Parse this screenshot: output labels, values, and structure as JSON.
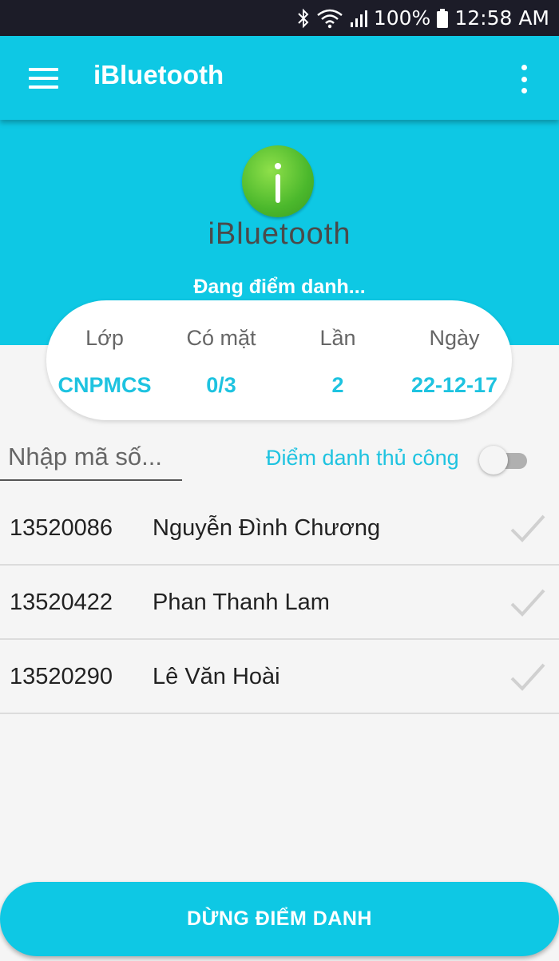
{
  "status_bar": {
    "battery": "100%",
    "time": "12:58 AM",
    "icons": [
      "bluetooth-icon",
      "wifi-icon",
      "signal-icon",
      "battery-icon"
    ]
  },
  "app_bar": {
    "title": "iBluetooth",
    "icons": [
      "menu-icon",
      "more-vert-icon"
    ]
  },
  "hero": {
    "logo_text": "iBluetooth",
    "status": "Đang điểm danh..."
  },
  "summary": [
    {
      "label": "Lớp",
      "value": "CNPMCS"
    },
    {
      "label": "Có mặt",
      "value": "0/3"
    },
    {
      "label": "Lần",
      "value": "2"
    },
    {
      "label": "Ngày",
      "value": "22-12-17"
    }
  ],
  "search": {
    "placeholder": "Nhập mã số...",
    "value": ""
  },
  "manual": {
    "label": "Điểm danh thủ công",
    "enabled": false
  },
  "students": [
    {
      "id": "13520086",
      "name": "Nguyễn Đình Chương",
      "present": false
    },
    {
      "id": "13520422",
      "name": "Phan Thanh Lam",
      "present": false
    },
    {
      "id": "13520290",
      "name": "Lê Văn Hoài",
      "present": false
    }
  ],
  "stop_button": "DỪNG ĐIỂM DANH",
  "colors": {
    "primary": "#0ec8e4",
    "accent_text": "#1ec3e0",
    "logo_green": "#4bb82c",
    "status_bar": "#1c1c28",
    "check_inactive": "#d0d0d0"
  }
}
